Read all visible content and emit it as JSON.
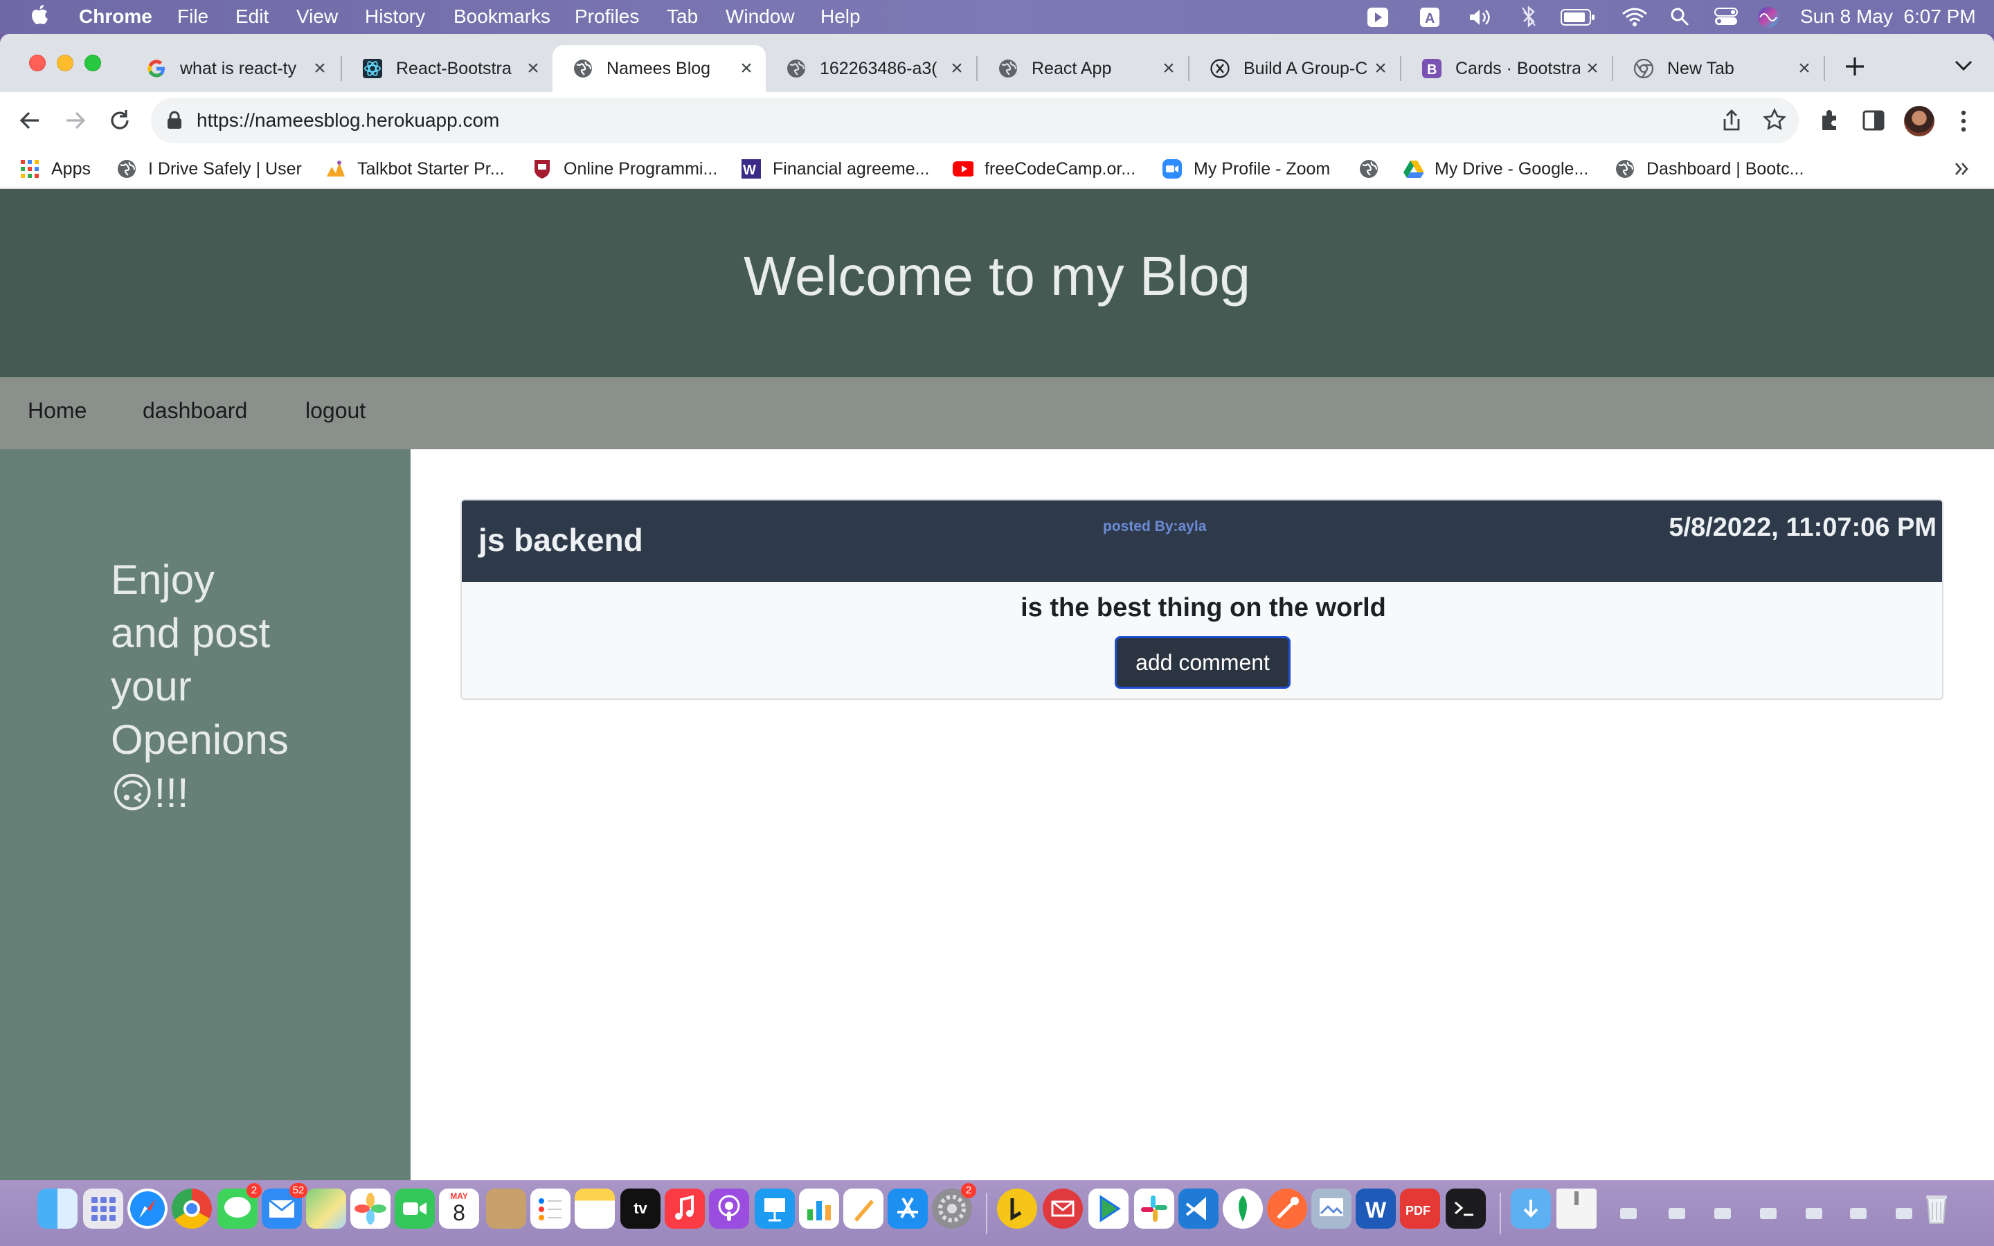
{
  "menubar": {
    "app_name": "Chrome",
    "items": [
      "File",
      "Edit",
      "View",
      "History",
      "Bookmarks",
      "Profiles",
      "Tab",
      "Window",
      "Help"
    ],
    "datetime": "Sun 8 May  6:07 PM"
  },
  "tabs": [
    {
      "title": "what is react-ty",
      "icon": "google-icon"
    },
    {
      "title": "React-Bootstra",
      "icon": "react-bootstrap-icon"
    },
    {
      "title": "Namees Blog",
      "icon": "globe-icon",
      "active": true
    },
    {
      "title": "162263486-a3(",
      "icon": "globe-icon"
    },
    {
      "title": "React App",
      "icon": "globe-icon"
    },
    {
      "title": "Build A Group-C",
      "icon": "x-circle-icon"
    },
    {
      "title": "Cards · Bootstra",
      "icon": "bootstrap-icon"
    },
    {
      "title": "New Tab",
      "icon": "chrome-icon"
    }
  ],
  "address": {
    "url": "https://nameesblog.herokuapp.com"
  },
  "bookmarks": [
    {
      "label": "Apps",
      "icon": "apps-grid-icon"
    },
    {
      "label": "I Drive Safely | User",
      "icon": "globe-icon"
    },
    {
      "label": "Talkbot Starter Pr...",
      "icon": "talkbot-icon"
    },
    {
      "label": "Online Programmi...",
      "icon": "harvard-shield-icon"
    },
    {
      "label": "Financial agreeme...",
      "icon": "w-icon"
    },
    {
      "label": "freeCodeCamp.or...",
      "icon": "youtube-icon"
    },
    {
      "label": "My Profile - Zoom",
      "icon": "zoom-icon"
    },
    {
      "label": "",
      "icon": "globe-icon"
    },
    {
      "label": "My Drive - Google...",
      "icon": "google-drive-icon"
    },
    {
      "label": "Dashboard | Bootc...",
      "icon": "globe-icon"
    }
  ],
  "blog": {
    "header_title": "Welcome to my Blog",
    "nav": [
      "Home",
      "dashboard",
      "logout"
    ],
    "sidebar_lines": [
      "Enjoy",
      "and post",
      "your",
      "Openions",
      "🙃!!!"
    ],
    "post": {
      "title": "js backend",
      "posted_by": "posted By:ayla",
      "date": "5/8/2022, 11:07:06 PM",
      "body": "is the best thing on the world",
      "button": "add comment"
    }
  },
  "dock": {
    "calendar_month": "MAY",
    "calendar_day": "8",
    "messages_badge": "2",
    "mail_badge": "52",
    "settings_badge": "2",
    "tv_label": "tv"
  },
  "colors": {
    "header_bg": "#445a52",
    "nav_bg": "#8a918c",
    "sidebar_bg": "#667f77",
    "card_header_bg": "#2e3a4a",
    "button_bg": "#2b3441",
    "button_border": "#1f4fd1"
  }
}
